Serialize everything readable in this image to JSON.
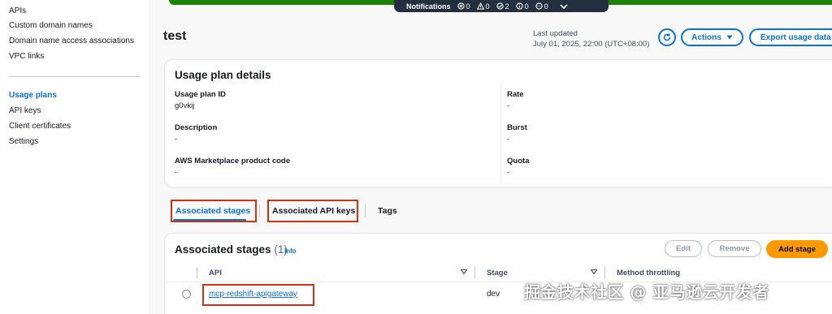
{
  "sidebar": {
    "items": [
      {
        "label": "APIs"
      },
      {
        "label": "Custom domain names"
      },
      {
        "label": "Domain name access associations"
      },
      {
        "label": "VPC links"
      },
      {
        "label": "Usage plans"
      },
      {
        "label": "API keys"
      },
      {
        "label": "Client certificates"
      },
      {
        "label": "Settings"
      }
    ]
  },
  "notifications": {
    "label": "Notifications",
    "counts": [
      {
        "icon": "error-icon",
        "value": "0"
      },
      {
        "icon": "warning-icon",
        "value": "0"
      },
      {
        "icon": "success-icon",
        "value": "2"
      },
      {
        "icon": "info-icon",
        "value": "0"
      },
      {
        "icon": "in-progress-icon",
        "value": "0"
      }
    ]
  },
  "header": {
    "title": "test",
    "last_updated_label": "Last updated",
    "last_updated_value": "July 01, 2025, 22:00 (UTC+08:00)",
    "actions_label": "Actions",
    "export_label": "Export usage data"
  },
  "details": {
    "title": "Usage plan details",
    "usage_plan_id_label": "Usage plan ID",
    "usage_plan_id_value": "g0vkij",
    "description_label": "Description",
    "description_value": "-",
    "marketplace_label": "AWS Marketplace product code",
    "marketplace_value": "-",
    "rate_label": "Rate",
    "rate_value": "-",
    "burst_label": "Burst",
    "burst_value": "-",
    "quota_label": "Quota",
    "quota_value": "-"
  },
  "tabs": [
    {
      "label": "Associated stages"
    },
    {
      "label": "Associated API keys"
    },
    {
      "label": "Tags"
    }
  ],
  "stages": {
    "title": "Associated stages",
    "count": "(1)",
    "info_label": "Info",
    "edit_label": "Edit",
    "remove_label": "Remove",
    "add_label": "Add stage",
    "columns": [
      "API",
      "Stage",
      "Method throttling"
    ],
    "rows": [
      {
        "api": "mcp-redshift-apigateway",
        "stage": "dev"
      }
    ]
  },
  "watermark": "掘金技术社区 @ 亚马逊云开发者",
  "colors": {
    "accent": "#0972d3",
    "success_banner": "#1d8102",
    "primary_button": "#ff9900",
    "highlight_box": "#d13212"
  }
}
